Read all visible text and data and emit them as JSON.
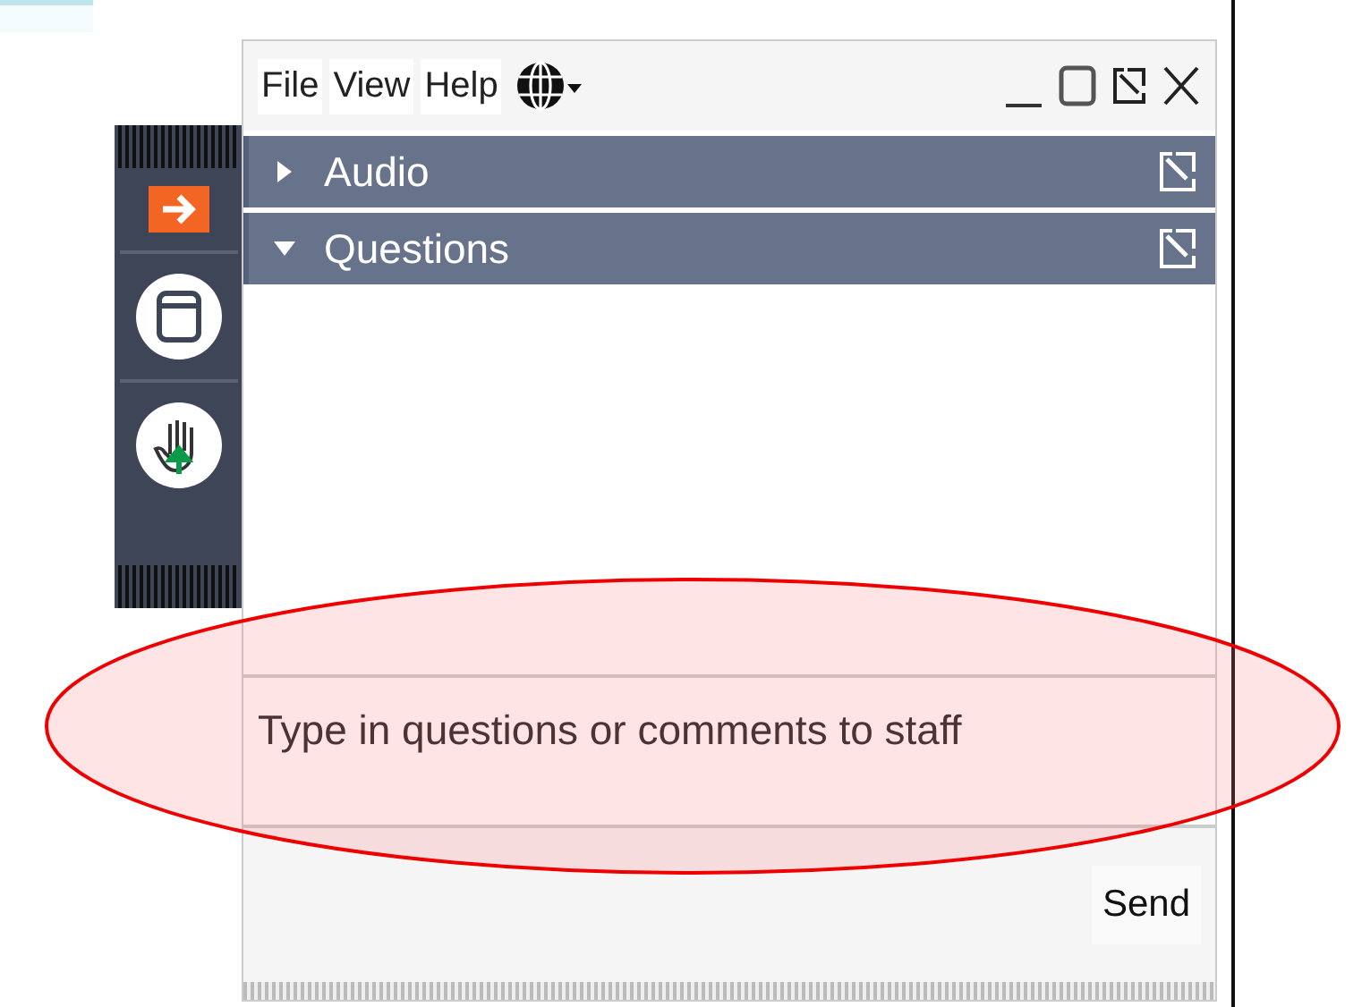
{
  "menu": [
    {
      "label": "File"
    },
    {
      "label": "View"
    },
    {
      "label": "Help"
    }
  ],
  "panels": [
    {
      "title": "Audio",
      "expanded": false
    },
    {
      "title": "Questions",
      "expanded": true
    }
  ],
  "question_box": {
    "placeholder": "Type in questions or comments to staff"
  },
  "send_button": {
    "label": "Send"
  }
}
